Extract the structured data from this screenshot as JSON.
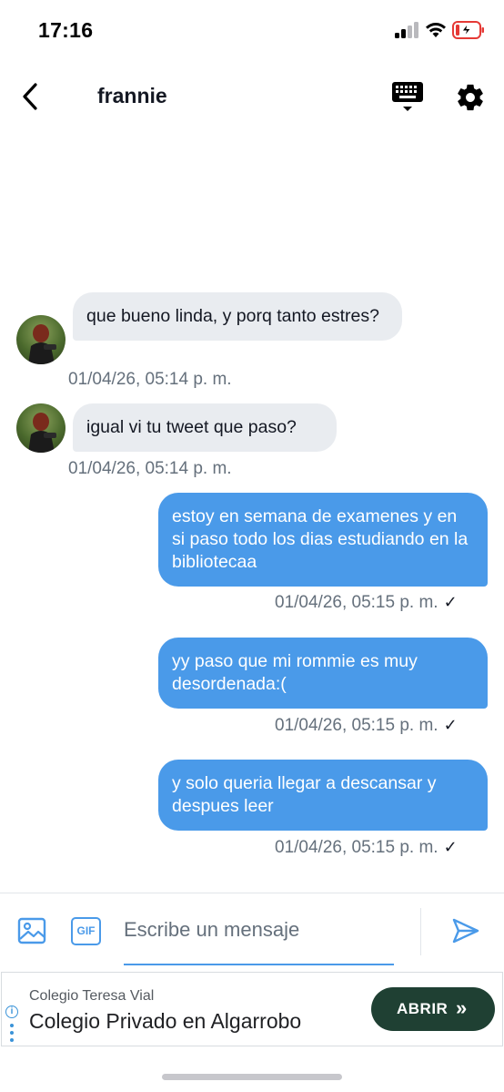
{
  "status_bar": {
    "time": "17:16"
  },
  "header": {
    "title": "frannie"
  },
  "messages": [
    {
      "direction": "in",
      "text": "que bueno linda, y porq tanto estres?",
      "timestamp": "01/04/26, 05:14 p. m."
    },
    {
      "direction": "in",
      "text": "igual vi tu tweet que paso?",
      "timestamp": "01/04/26, 05:14 p. m."
    },
    {
      "direction": "out",
      "text": "estoy en semana de examenes y en si paso todo los dias estudiando en la bibliotecaa",
      "timestamp": "01/04/26, 05:15 p. m.",
      "status_mark": "✓"
    },
    {
      "direction": "out",
      "text": "yy paso que mi rommie es muy desordenada:(",
      "timestamp": "01/04/26, 05:15 p. m.",
      "status_mark": "✓"
    },
    {
      "direction": "out",
      "text": "y solo queria llegar a descansar y despues leer",
      "timestamp": "01/04/26, 05:15 p. m.",
      "status_mark": "✓"
    }
  ],
  "composer": {
    "placeholder": "Escribe un mensaje",
    "value": "",
    "gif_label": "GIF"
  },
  "ad": {
    "sponsor": "Colegio Teresa Vial",
    "title": "Colegio Privado en Algarrobo",
    "cta": "ABRIR",
    "cta_icon": "»"
  },
  "icons": {
    "back": "back-arrow-icon",
    "keyboard": "keyboard-icon",
    "settings": "gear-icon",
    "image": "image-icon",
    "gif": "gif-icon",
    "send": "send-icon"
  },
  "colors": {
    "accent": "#4a9ae9",
    "incoming_bubble": "#e9ecf0",
    "timestamp": "#65707c",
    "ad_button": "#1f4033",
    "battery_low": "#e53935"
  }
}
